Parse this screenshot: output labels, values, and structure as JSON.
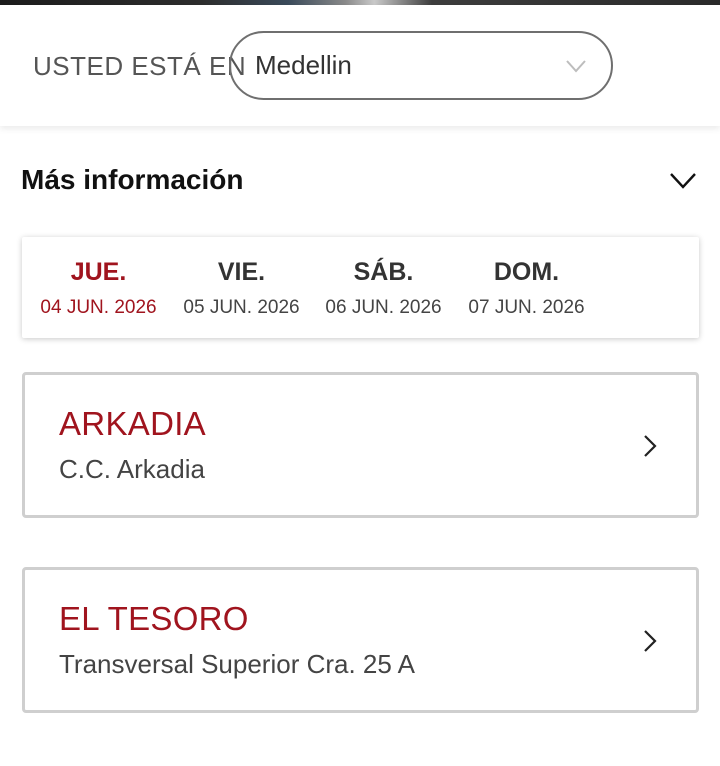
{
  "location": {
    "label": "USTED ESTÁ EN",
    "selected_city": "Medellin"
  },
  "more_info": {
    "title": "Más información"
  },
  "dates": [
    {
      "day": "JUE.",
      "date": "04 JUN. 2026",
      "active": true
    },
    {
      "day": "VIE.",
      "date": "05 JUN. 2026",
      "active": false
    },
    {
      "day": "SÁB.",
      "date": "06 JUN. 2026",
      "active": false
    },
    {
      "day": "DOM.",
      "date": "07 JUN. 2026",
      "active": false
    }
  ],
  "cinemas": [
    {
      "name": "ARKADIA",
      "address": "C.C. Arkadia"
    },
    {
      "name": "EL TESORO",
      "address": "Transversal Superior Cra. 25 A"
    }
  ],
  "colors": {
    "accent": "#a0141e",
    "card_border": "#cfcfcf",
    "select_border": "#6f6f6f"
  },
  "icons": {
    "select_arrow": "chevron-down-icon",
    "expand_arrow": "chevron-down-icon",
    "card_arrow": "chevron-right-icon"
  }
}
